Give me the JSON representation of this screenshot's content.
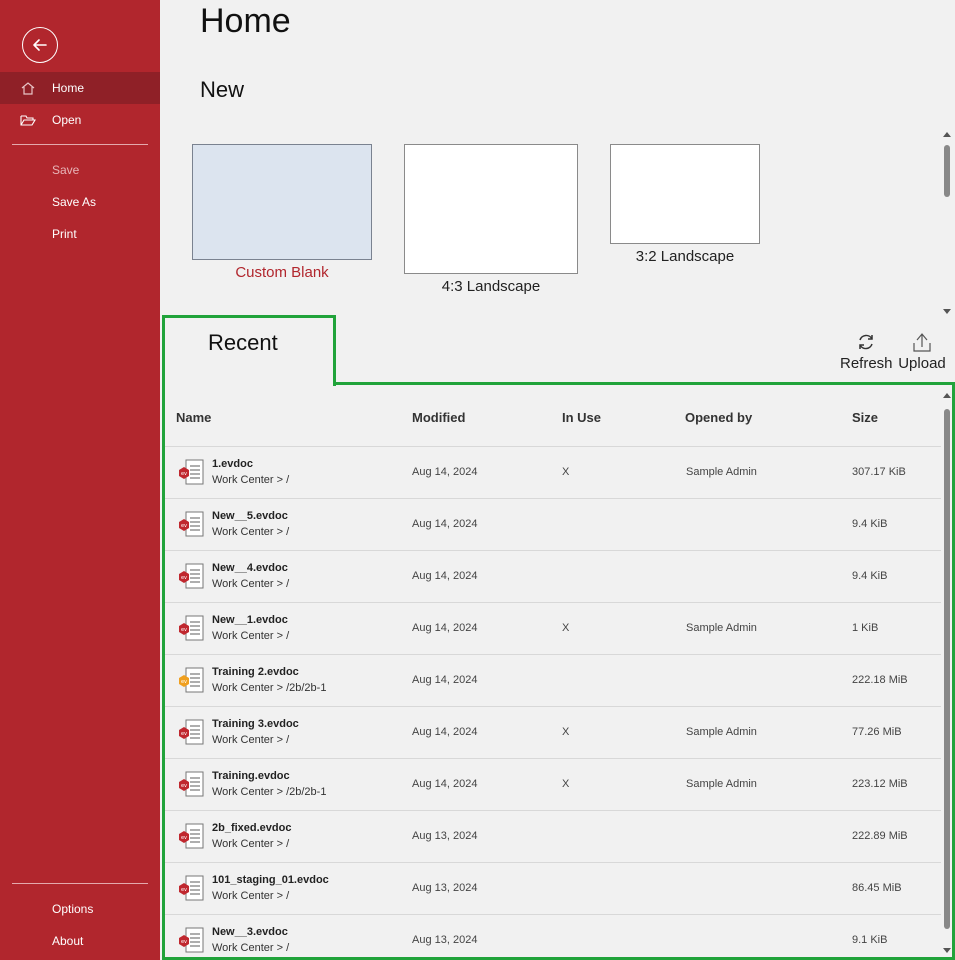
{
  "sidebar": {
    "back_icon": "arrow-left-icon",
    "items": [
      {
        "label": "Home",
        "icon": "home-icon",
        "active": true
      },
      {
        "label": "Open",
        "icon": "folder-open-icon"
      },
      {
        "label": "Save",
        "disabled": true
      },
      {
        "label": "Save As"
      },
      {
        "label": "Print"
      }
    ],
    "footer_items": [
      {
        "label": "Options"
      },
      {
        "label": "About"
      }
    ]
  },
  "page": {
    "title": "Home",
    "new_section": "New"
  },
  "templates": [
    {
      "label": "Custom Blank"
    },
    {
      "label": "4:3 Landscape"
    },
    {
      "label": "3:2 Landscape"
    }
  ],
  "recent": {
    "title": "Recent",
    "refresh_label": "Refresh",
    "upload_label": "Upload",
    "columns": {
      "name": "Name",
      "modified": "Modified",
      "in_use": "In Use",
      "opened_by": "Opened by",
      "size": "Size"
    },
    "rows": [
      {
        "name": "1.evdoc",
        "path": "Work Center > /",
        "modified": "Aug 14, 2024",
        "in_use": "X",
        "opened_by": "Sample Admin",
        "size": "307.17 KiB",
        "icon_color": "#c0282f"
      },
      {
        "name": "New__5.evdoc",
        "path": "Work Center > /",
        "modified": "Aug 14, 2024",
        "in_use": "",
        "opened_by": "",
        "size": "9.4 KiB",
        "icon_color": "#c0282f"
      },
      {
        "name": "New__4.evdoc",
        "path": "Work Center > /",
        "modified": "Aug 14, 2024",
        "in_use": "",
        "opened_by": "",
        "size": "9.4 KiB",
        "icon_color": "#c0282f"
      },
      {
        "name": "New__1.evdoc",
        "path": "Work Center > /",
        "modified": "Aug 14, 2024",
        "in_use": "X",
        "opened_by": "Sample Admin",
        "size": "1 KiB",
        "icon_color": "#c0282f"
      },
      {
        "name": "Training 2.evdoc",
        "path": "Work Center > /2b/2b-1",
        "modified": "Aug 14, 2024",
        "in_use": "",
        "opened_by": "",
        "size": "222.18 MiB",
        "icon_color": "#f0a020"
      },
      {
        "name": "Training 3.evdoc",
        "path": "Work Center > /",
        "modified": "Aug 14, 2024",
        "in_use": "X",
        "opened_by": "Sample Admin",
        "size": "77.26 MiB",
        "icon_color": "#c0282f"
      },
      {
        "name": "Training.evdoc",
        "path": "Work Center > /2b/2b-1",
        "modified": "Aug 14, 2024",
        "in_use": "X",
        "opened_by": "Sample Admin",
        "size": "223.12 MiB",
        "icon_color": "#c0282f"
      },
      {
        "name": "2b_fixed.evdoc",
        "path": "Work Center > /",
        "modified": "Aug 13, 2024",
        "in_use": "",
        "opened_by": "",
        "size": "222.89 MiB",
        "icon_color": "#c0282f"
      },
      {
        "name": "101_staging_01.evdoc",
        "path": "Work Center > /",
        "modified": "Aug 13, 2024",
        "in_use": "",
        "opened_by": "",
        "size": "86.45 MiB",
        "icon_color": "#c0282f"
      },
      {
        "name": "New__3.evdoc",
        "path": "Work Center > /",
        "modified": "Aug 13, 2024",
        "in_use": "",
        "opened_by": "",
        "size": "9.1 KiB",
        "icon_color": "#c0282f"
      }
    ]
  },
  "colors": {
    "sidebar_bg": "#b1262d",
    "sidebar_active": "#8f2027",
    "highlight_border": "#21a33a",
    "accent_text": "#b1262d"
  }
}
